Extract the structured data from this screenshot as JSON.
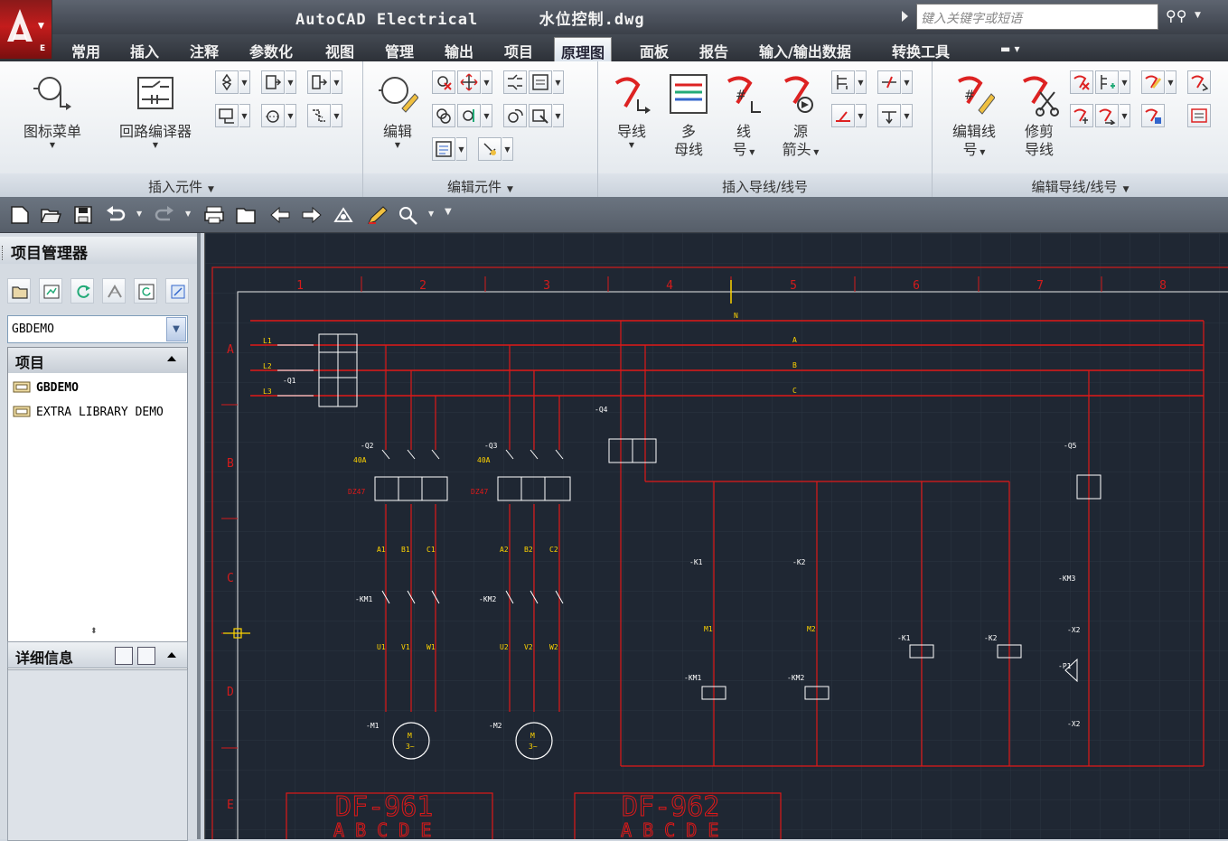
{
  "title": {
    "app": "AutoCAD Electrical",
    "file": "水位控制.dwg"
  },
  "search": {
    "placeholder": "键入关键字或短语"
  },
  "tabs": [
    {
      "label": "常用"
    },
    {
      "label": "插入"
    },
    {
      "label": "注释"
    },
    {
      "label": "参数化"
    },
    {
      "label": "视图"
    },
    {
      "label": "管理"
    },
    {
      "label": "输出"
    },
    {
      "label": "项目"
    },
    {
      "label": "原理图",
      "active": true
    },
    {
      "label": "面板"
    },
    {
      "label": "报告"
    },
    {
      "label": "输入/输出数据"
    },
    {
      "label": "转换工具"
    }
  ],
  "ribbon": {
    "panels": [
      {
        "title": "插入元件"
      },
      {
        "title": "编辑元件"
      },
      {
        "title": "插入导线/线号"
      },
      {
        "title": "编辑导线/线号"
      }
    ],
    "buttons": {
      "icon_menu": "图标菜单",
      "circuit_compiler": "回路编译器",
      "edit": "编辑",
      "wire": "导线",
      "multi_bus_line1": "多",
      "multi_bus_line2": "母线",
      "wire_number_line1": "线",
      "wire_number_line2": "号",
      "source_arrow_line1": "源",
      "source_arrow_line2": "箭头",
      "edit_wire_number_line1": "编辑线",
      "edit_wire_number_line2": "号",
      "trim_wire_line1": "修剪",
      "trim_wire_line2": "导线"
    }
  },
  "palette": {
    "title": "项目管理器",
    "selected_project": "GBDEMO",
    "list_header": "项目",
    "projects": [
      {
        "name": "GBDEMO",
        "active": true
      },
      {
        "name": "EXTRA LIBRARY DEMO",
        "active": false
      }
    ],
    "details_title": "详细信息"
  },
  "drawing": {
    "columns": [
      "1",
      "2",
      "3",
      "4",
      "5",
      "6",
      "7",
      "8"
    ],
    "rows": [
      "A",
      "B",
      "C",
      "D",
      "E"
    ],
    "lines": [
      "L1",
      "L2",
      "L3"
    ],
    "buses": [
      "N",
      "A",
      "B",
      "C"
    ],
    "title_blocks": [
      {
        "label": "DF-961",
        "phases": "A B C D E"
      },
      {
        "label": "DF-962",
        "phases": "A B C D E"
      }
    ],
    "breakers": [
      {
        "tag": "-Q2",
        "rating": "40A",
        "model": "DZ47"
      },
      {
        "tag": "-Q3",
        "rating": "40A",
        "model": "DZ47"
      }
    ],
    "contactors": [
      "-KM1",
      "-KM2"
    ],
    "motors": [
      "-M1",
      "-M2"
    ],
    "relays": [
      "-K1",
      "-K2"
    ],
    "misc_tags": [
      "-Q1",
      "-Q4",
      "-Q5",
      "-P1",
      "-X2",
      "-KM3"
    ],
    "terminal_labels_a": [
      "A1",
      "B1",
      "C1",
      "U1",
      "V1",
      "W1"
    ],
    "terminal_labels_b": [
      "A2",
      "B2",
      "C2",
      "U2",
      "V2",
      "W2"
    ],
    "coil_labels": [
      "M1",
      "M2"
    ],
    "motor_symbol": {
      "line1": "M",
      "line2": "3~"
    }
  }
}
